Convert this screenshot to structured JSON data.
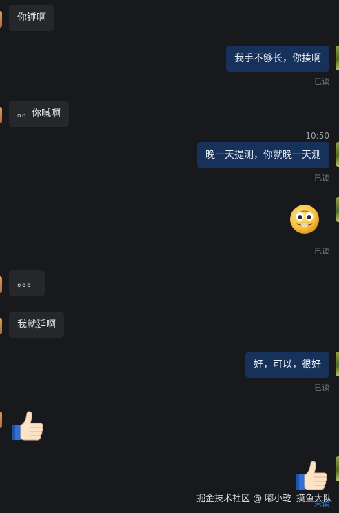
{
  "messages": [
    {
      "text": "你锤啊"
    },
    {
      "text": "我手不够长，你揍啊",
      "status": "已读"
    },
    {
      "text": "。。你喊啊"
    },
    {
      "text": "晚一天提测，你就晚一天测",
      "status": "已读"
    },
    {
      "sticker": "grinning-face-with-bandage-sticker",
      "status": "已读"
    },
    {
      "text": "。。。"
    },
    {
      "text": "我就延啊"
    },
    {
      "text": "好，可以，很好",
      "status": "已读"
    },
    {
      "sticker": "thumbs-up-sticker"
    },
    {
      "sticker": "thumbs-up-sticker",
      "status": "未读"
    }
  ],
  "timestamp": "10:50",
  "watermark": "掘金技术社区 @ 嘟小乾_摸鱼大队",
  "colors": {
    "background": "#17191c",
    "incoming_bubble": "#25272b",
    "outgoing_bubble": "#17325a",
    "unread": "#3a86e8"
  }
}
